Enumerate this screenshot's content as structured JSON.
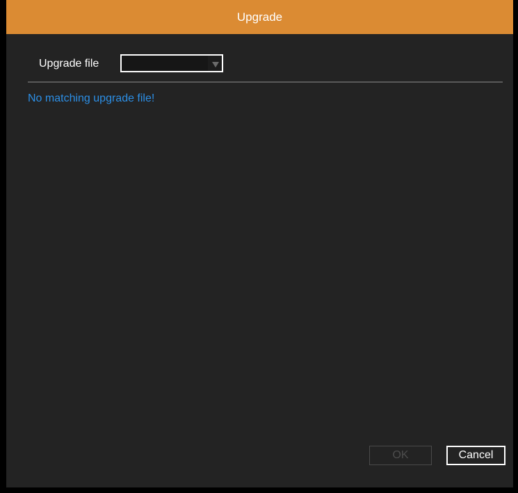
{
  "dialog": {
    "title": "Upgrade",
    "accent_color": "#db8b33",
    "background_color": "#232323"
  },
  "upgrade_file": {
    "label": "Upgrade file",
    "selected_value": "",
    "dropdown_icon": "chevron-down-icon"
  },
  "message": {
    "text": "No matching upgrade file!",
    "color": "#2c8fe6"
  },
  "buttons": {
    "ok_label": "OK",
    "ok_enabled": false,
    "cancel_label": "Cancel"
  }
}
